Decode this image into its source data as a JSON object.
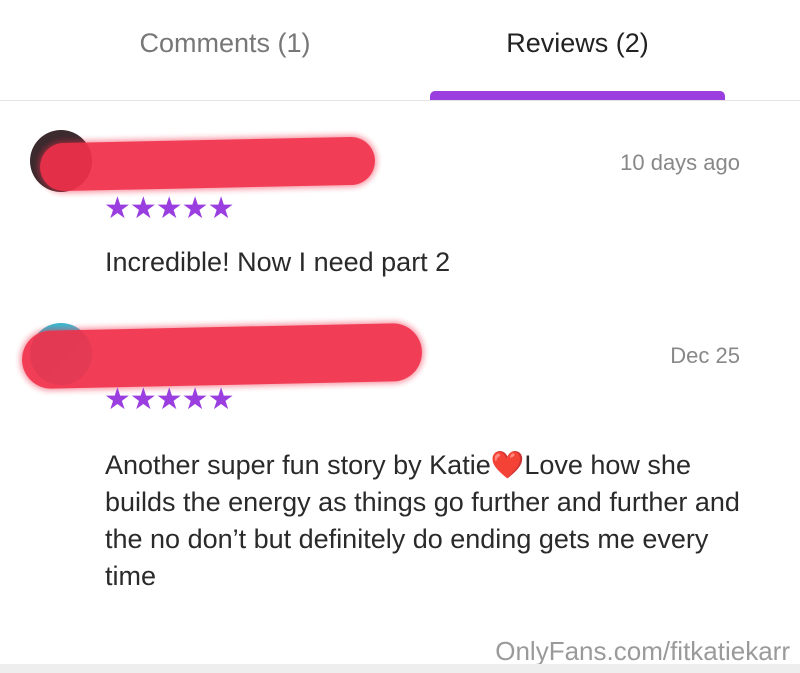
{
  "tabs": [
    {
      "label": "Comments (1)",
      "active": false
    },
    {
      "label": "Reviews (2)",
      "active": true
    }
  ],
  "accent_color": "#9a3ee0",
  "reviews": [
    {
      "author_redacted": true,
      "time": "10 days ago",
      "rating": 5,
      "stars": "★★★★★",
      "text_before_heart": "Incredible! Now I need part 2",
      "heart": "",
      "text_after_heart": ""
    },
    {
      "author_redacted": true,
      "time": "Dec 25",
      "rating": 5,
      "stars": "★★★★★",
      "text_before_heart": "Another super fun story by Katie",
      "heart": "❤️",
      "text_after_heart": "Love how she builds the energy as things go further and further and the no don’t but definitely do ending gets me every time"
    }
  ],
  "watermark": "OnlyFans.com/fitkatiekarr"
}
